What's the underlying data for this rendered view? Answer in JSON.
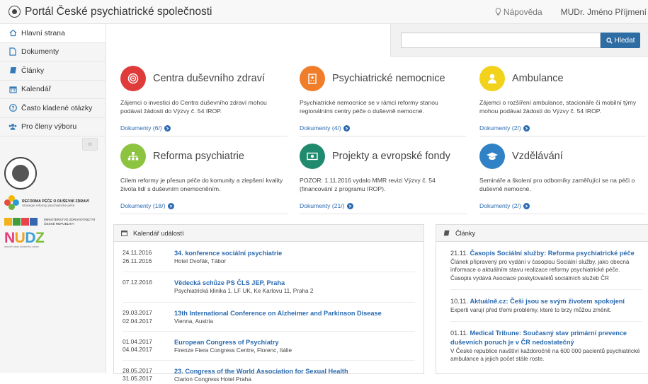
{
  "header": {
    "brand": "Portál České psychiatrické společnosti",
    "help": "Nápověda",
    "user": "MUDr. Jméno Příjmení"
  },
  "sidebar": {
    "items": [
      {
        "label": "Hlavní strana",
        "icon": "home-icon"
      },
      {
        "label": "Dokumenty",
        "icon": "document-icon"
      },
      {
        "label": "Články",
        "icon": "book-icon"
      },
      {
        "label": "Kalendář",
        "icon": "calendar-icon"
      },
      {
        "label": "Často kladené otázky",
        "icon": "question-icon"
      },
      {
        "label": "Pro členy výboru",
        "icon": "users-icon"
      }
    ],
    "collapse": "«",
    "logos": {
      "reforma_title": "REFORMA PÉČE O DUŠEVNÍ ZDRAVÍ",
      "reforma_sub": "Strategie reformy psychiatrické péče",
      "mz_line1": "MINISTERSTVO ZDRAVOTNICTVÍ",
      "mz_line2": "ČESKÉ REPUBLIKY",
      "nudz": "NUDZ",
      "nudz_sub": "národní ústav duševního zdraví"
    }
  },
  "search": {
    "placeholder": "",
    "button": "Hledat"
  },
  "topics": [
    {
      "title": "Centra duševního zdraví",
      "desc": "Zájemci o investici do Centra duševního zdraví mohou podávat žádosti do Výzvy č. 54 IROP.",
      "link": "Dokumenty (6/)",
      "color": "#e03b3b",
      "icon": "target-icon"
    },
    {
      "title": "Psychiatrické nemocnice",
      "desc": "Psychiatrické nemocnice se v rámci reformy stanou regionálními centry péče o duševně nemocné.",
      "link": "Dokumenty (4/)",
      "color": "#f07d2a",
      "icon": "hospital-icon"
    },
    {
      "title": "Ambulance",
      "desc": "Zájemci o rozšíření ambulance, stacionáře či mobilní týmy mohou podávat žádosti do Výzvy č. 54 IROP.",
      "link": "Dokumenty (2/)",
      "color": "#f2d21a",
      "icon": "user-icon"
    },
    {
      "title": "Reforma psychiatrie",
      "desc": "Cílem reformy je přesun péče do komunity a zlepšení kvality života lidí s duševním onemocněním.",
      "link": "Dokumenty (18/)",
      "color": "#8cc43f",
      "icon": "sitemap-icon"
    },
    {
      "title": "Projekty a evropské fondy",
      "desc": "POZOR: 1.11.2016 vydalo MMR revizi Výzvy č. 54 (financování z programu IROP).",
      "link": "Dokumenty (21/)",
      "color": "#1f8a6d",
      "icon": "money-icon"
    },
    {
      "title": "Vzdělávání",
      "desc": "Semináře a školení pro odborníky zaměřující se na péči o duševně nemocné.",
      "link": "Dokumenty (2/)",
      "color": "#2f82c5",
      "icon": "graduation-cap-icon"
    }
  ],
  "calendar": {
    "title": "Kalendář událostí",
    "events": [
      {
        "date1": "24.11.2016",
        "date2": "26.11.2016",
        "name": "34. konference sociální psychiatrie",
        "place": "Hotel Dvořák, Tábor"
      },
      {
        "date1": "07.12.2016",
        "date2": "",
        "name": "Vědecká schůze PS ČLS JEP, Praha",
        "place": "Psychiatrická klinika 1. LF UK, Ke Karlovu 11, Praha 2"
      },
      {
        "date1": "29.03.2017",
        "date2": "02.04.2017",
        "name": "13th International Conference on Alzheimer and Parkinson Disease",
        "place": "Vienna, Austria"
      },
      {
        "date1": "01.04.2017",
        "date2": "04.04.2017",
        "name": "European Congress of Psychiatry",
        "place": "Firenze Fiera Congress Centre, Florenc, Itálie"
      },
      {
        "date1": "28.05.2017",
        "date2": "31.05.2017",
        "name": "23. Congress of the World Association for Sexual Health",
        "place": "Clarion Congress Hotel Praha"
      }
    ]
  },
  "articles": {
    "title": "Články",
    "items": [
      {
        "date": "21.11.",
        "title": "Časopis Sociální služby: Reforma psychiatrické péče",
        "body": "Článek připravený pro vydání v časopisu Sociální služby, jako obecná informace o aktuálním stavu realizace reformy psychiatrické péče. Časopis vydává Asociace poskytovatelů sociálních služeb ČR"
      },
      {
        "date": "10.11.",
        "title": "Aktuálně.cz: Češi jsou se svým životem spokojení",
        "body": "Experti varují před třemi problémy, které to brzy můžou změnit."
      },
      {
        "date": "01.11.",
        "title": "Medical Tribune: Současný stav primární prevence duševních poruch je v ČR nedostatečný",
        "body": "V České republice navštíví každoročně na 600 000 pacientů psychiatrické ambulance a jejich počet stále roste."
      }
    ]
  }
}
